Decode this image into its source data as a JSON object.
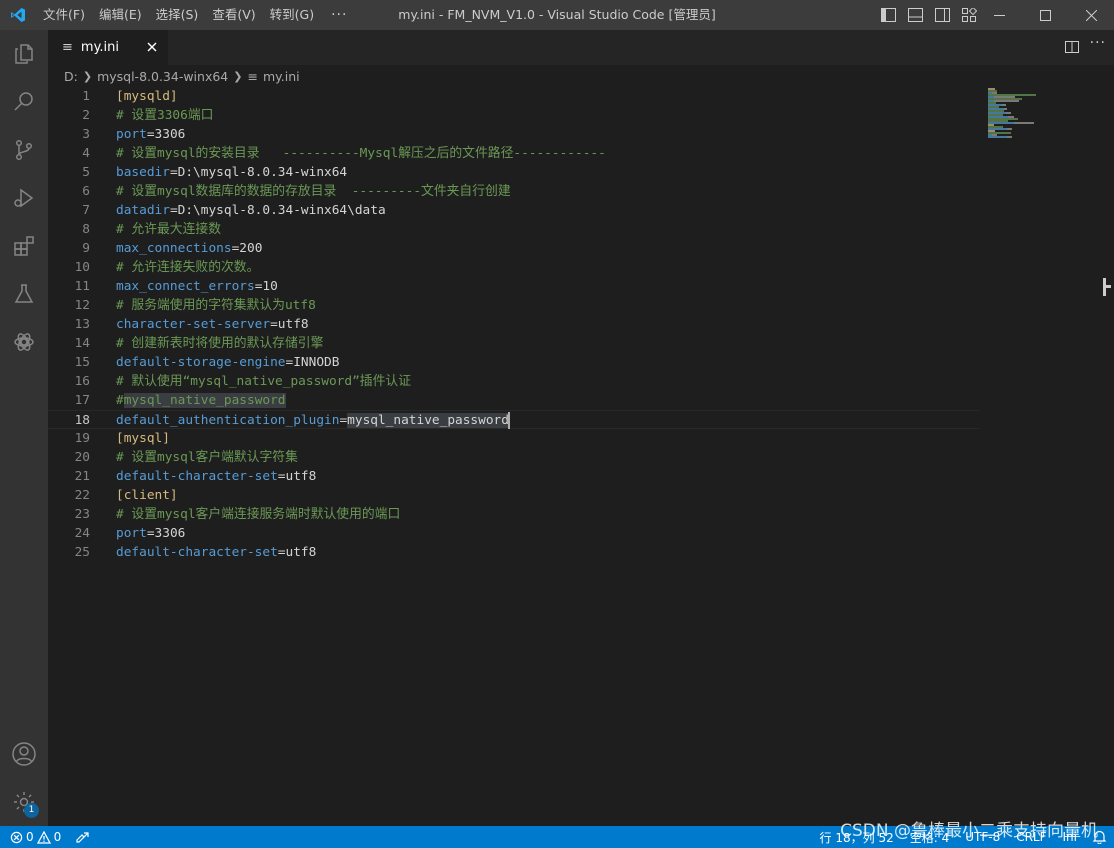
{
  "titlebar": {
    "menus": [
      "文件(F)",
      "编辑(E)",
      "选择(S)",
      "查看(V)",
      "转到(G)"
    ],
    "more": "···",
    "window_title": "my.ini - FM_NVM_V1.0 - Visual Studio Code [管理员]"
  },
  "activity": {
    "badge": "1"
  },
  "tab": {
    "label": "my.ini",
    "icon": "≡"
  },
  "breadcrumb": {
    "drive": "D:",
    "folder": "mysql-8.0.34-winx64",
    "file": "my.ini"
  },
  "editor": {
    "current_line": 18,
    "lines": [
      {
        "n": "1",
        "parts": [
          {
            "t": "[mysqld]",
            "c": "section"
          }
        ]
      },
      {
        "n": "2",
        "parts": [
          {
            "t": "# 设置3306端口",
            "c": "comment"
          }
        ]
      },
      {
        "n": "3",
        "parts": [
          {
            "t": "port",
            "c": "key"
          },
          {
            "t": "=3306",
            "c": "val"
          }
        ]
      },
      {
        "n": "4",
        "parts": [
          {
            "t": "# 设置mysql的安装目录   ----------Mysql解压之后的文件路径------------",
            "c": "comment"
          }
        ]
      },
      {
        "n": "5",
        "parts": [
          {
            "t": "basedir",
            "c": "key"
          },
          {
            "t": "=D:\\mysql-8.0.34-winx64",
            "c": "val"
          }
        ]
      },
      {
        "n": "6",
        "parts": [
          {
            "t": "# 设置mysql数据库的数据的存放目录  ---------文件夹自行创建",
            "c": "comment"
          }
        ]
      },
      {
        "n": "7",
        "parts": [
          {
            "t": "datadir",
            "c": "key"
          },
          {
            "t": "=D:\\mysql-8.0.34-winx64\\data",
            "c": "val"
          }
        ]
      },
      {
        "n": "8",
        "parts": [
          {
            "t": "# 允许最大连接数",
            "c": "comment"
          }
        ]
      },
      {
        "n": "9",
        "parts": [
          {
            "t": "max_connections",
            "c": "key"
          },
          {
            "t": "=200",
            "c": "val"
          }
        ]
      },
      {
        "n": "10",
        "parts": [
          {
            "t": "# 允许连接失败的次数。",
            "c": "comment"
          }
        ]
      },
      {
        "n": "11",
        "parts": [
          {
            "t": "max_connect_errors",
            "c": "key"
          },
          {
            "t": "=10",
            "c": "val"
          }
        ]
      },
      {
        "n": "12",
        "parts": [
          {
            "t": "# 服务端使用的字符集默认为utf8",
            "c": "comment"
          }
        ]
      },
      {
        "n": "13",
        "parts": [
          {
            "t": "character-set-server",
            "c": "key"
          },
          {
            "t": "=utf8",
            "c": "val"
          }
        ]
      },
      {
        "n": "14",
        "parts": [
          {
            "t": "# 创建新表时将使用的默认存储引擎",
            "c": "comment"
          }
        ]
      },
      {
        "n": "15",
        "parts": [
          {
            "t": "default-storage-engine",
            "c": "key"
          },
          {
            "t": "=INNODB",
            "c": "val"
          }
        ]
      },
      {
        "n": "16",
        "parts": [
          {
            "t": "# 默认使用“mysql_native_password”插件认证",
            "c": "comment"
          }
        ]
      },
      {
        "n": "17",
        "parts": [
          {
            "t": "#",
            "c": "comment"
          },
          {
            "t": "mysql_native_password",
            "c": "comment sel"
          }
        ]
      },
      {
        "n": "18",
        "parts": [
          {
            "t": "default_authentication_plugin",
            "c": "key"
          },
          {
            "t": "=",
            "c": "val"
          },
          {
            "t": "mysql_native_password",
            "c": "val sel"
          }
        ]
      },
      {
        "n": "19",
        "parts": [
          {
            "t": "[mysql]",
            "c": "section"
          }
        ]
      },
      {
        "n": "20",
        "parts": [
          {
            "t": "# 设置mysql客户端默认字符集",
            "c": "comment"
          }
        ]
      },
      {
        "n": "21",
        "parts": [
          {
            "t": "default-character-set",
            "c": "key"
          },
          {
            "t": "=utf8",
            "c": "val"
          }
        ]
      },
      {
        "n": "22",
        "parts": [
          {
            "t": "[client]",
            "c": "section"
          }
        ]
      },
      {
        "n": "23",
        "parts": [
          {
            "t": "# 设置mysql客户端连接服务端时默认使用的端口",
            "c": "comment"
          }
        ]
      },
      {
        "n": "24",
        "parts": [
          {
            "t": "port",
            "c": "key"
          },
          {
            "t": "=3306",
            "c": "val"
          }
        ]
      },
      {
        "n": "25",
        "parts": [
          {
            "t": "default-character-set",
            "c": "key"
          },
          {
            "t": "=utf8",
            "c": "val"
          }
        ]
      }
    ]
  },
  "statusbar": {
    "errors": "0",
    "warnings": "0",
    "position": "行 18，列 52",
    "spaces": "空格: 4",
    "encoding": "UTF-8",
    "eol": "CRLF",
    "language": "Ini"
  },
  "watermark": "CSDN @鲁棒最小二乘支持向量机",
  "colors": {
    "accent": "#007acc",
    "comment": "#6a9955",
    "key": "#569cd6",
    "section": "#d7ba7d"
  }
}
